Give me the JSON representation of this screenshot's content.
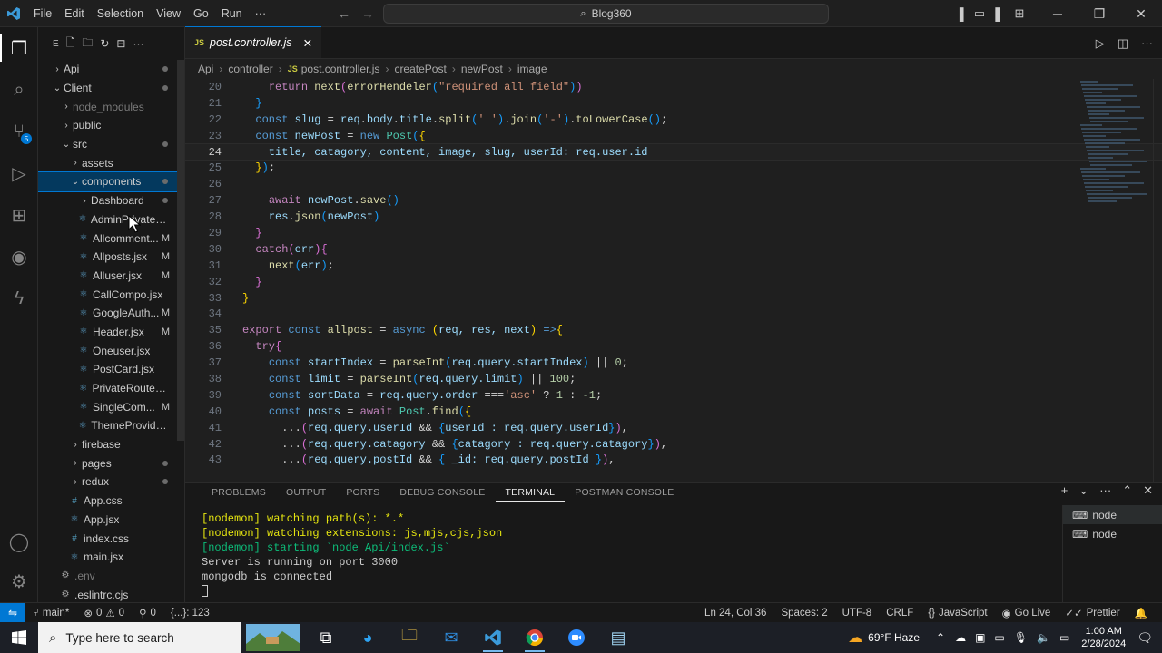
{
  "window": {
    "menu": [
      "File",
      "Edit",
      "Selection",
      "View",
      "Go",
      "Run",
      "···"
    ],
    "command_center": "Blog360"
  },
  "explorer": {
    "toolbar_letter": "E",
    "tree": [
      {
        "label": "Api",
        "indent": 1,
        "kind": "folder",
        "open": false,
        "dot": true
      },
      {
        "label": "Client",
        "indent": 1,
        "kind": "folder",
        "open": true,
        "dot": true
      },
      {
        "label": "node_modules",
        "indent": 2,
        "kind": "folder",
        "open": false,
        "dim": true
      },
      {
        "label": "public",
        "indent": 2,
        "kind": "folder",
        "open": false
      },
      {
        "label": "src",
        "indent": 2,
        "kind": "folder",
        "open": true,
        "dot": true
      },
      {
        "label": "assets",
        "indent": 3,
        "kind": "folder",
        "open": false
      },
      {
        "label": "components",
        "indent": 3,
        "kind": "folder",
        "open": true,
        "dot": true,
        "selected": true
      },
      {
        "label": "Dashboard",
        "indent": 4,
        "kind": "folder",
        "open": false,
        "dot": true
      },
      {
        "label": "AdminPrivateRou...",
        "indent": 4,
        "kind": "file"
      },
      {
        "label": "Allcomment...",
        "indent": 4,
        "kind": "file",
        "badge": "M"
      },
      {
        "label": "Allposts.jsx",
        "indent": 4,
        "kind": "file",
        "badge": "M"
      },
      {
        "label": "Alluser.jsx",
        "indent": 4,
        "kind": "file",
        "badge": "M"
      },
      {
        "label": "CallCompo.jsx",
        "indent": 4,
        "kind": "file"
      },
      {
        "label": "GoogleAuth...",
        "indent": 4,
        "kind": "file",
        "badge": "M"
      },
      {
        "label": "Header.jsx",
        "indent": 4,
        "kind": "file",
        "badge": "M"
      },
      {
        "label": "Oneuser.jsx",
        "indent": 4,
        "kind": "file"
      },
      {
        "label": "PostCard.jsx",
        "indent": 4,
        "kind": "file"
      },
      {
        "label": "PrivateRoute.jsx",
        "indent": 4,
        "kind": "file"
      },
      {
        "label": "SingleCom...",
        "indent": 4,
        "kind": "file",
        "badge": "M"
      },
      {
        "label": "ThemeProvider.jsx",
        "indent": 4,
        "kind": "file"
      },
      {
        "label": "firebase",
        "indent": 3,
        "kind": "folder",
        "open": false
      },
      {
        "label": "pages",
        "indent": 3,
        "kind": "folder",
        "open": false,
        "dot": true
      },
      {
        "label": "redux",
        "indent": 3,
        "kind": "folder",
        "open": false,
        "dot": true
      },
      {
        "label": "App.css",
        "indent": 3,
        "kind": "css"
      },
      {
        "label": "App.jsx",
        "indent": 3,
        "kind": "file"
      },
      {
        "label": "index.css",
        "indent": 3,
        "kind": "css"
      },
      {
        "label": "main.jsx",
        "indent": 3,
        "kind": "file"
      },
      {
        "label": ".env",
        "indent": 2,
        "kind": "gear",
        "dim": true
      },
      {
        "label": ".eslintrc.cjs",
        "indent": 2,
        "kind": "gear"
      }
    ]
  },
  "editor": {
    "tab": {
      "badge": "JS",
      "label": "post.controller.js"
    },
    "breadcrumb": [
      "Api",
      "controller",
      "JS",
      "post.controller.js",
      "createPost",
      "newPost",
      "image"
    ],
    "current_line": 24,
    "lines": [
      {
        "n": 20,
        "tokens": [
          [
            "    ",
            "pun"
          ],
          [
            "return ",
            "kc"
          ],
          [
            "next",
            "fn"
          ],
          [
            "(",
            "brk2"
          ],
          [
            "errorHendeler",
            "fn"
          ],
          [
            "(",
            "brk3"
          ],
          [
            "\"required all field\"",
            "str"
          ],
          [
            ")",
            "brk3"
          ],
          [
            ")",
            "brk2"
          ]
        ]
      },
      {
        "n": 21,
        "tokens": [
          [
            "  }",
            "brk3"
          ]
        ]
      },
      {
        "n": 22,
        "tokens": [
          [
            "  ",
            "pun"
          ],
          [
            "const ",
            "kw"
          ],
          [
            "slug",
            "var"
          ],
          [
            " = ",
            "pun"
          ],
          [
            "req",
            "var"
          ],
          [
            ".",
            "pun"
          ],
          [
            "body",
            "var"
          ],
          [
            ".",
            "pun"
          ],
          [
            "title",
            "var"
          ],
          [
            ".",
            "pun"
          ],
          [
            "split",
            "fn"
          ],
          [
            "(",
            "brk3"
          ],
          [
            "' '",
            "str"
          ],
          [
            ")",
            "brk3"
          ],
          [
            ".",
            "pun"
          ],
          [
            "join",
            "fn"
          ],
          [
            "(",
            "brk3"
          ],
          [
            "'-'",
            "str"
          ],
          [
            ")",
            "brk3"
          ],
          [
            ".",
            "pun"
          ],
          [
            "toLowerCase",
            "fn"
          ],
          [
            "()",
            "brk3"
          ],
          [
            ";",
            "pun"
          ]
        ]
      },
      {
        "n": 23,
        "tokens": [
          [
            "  ",
            "pun"
          ],
          [
            "const ",
            "kw"
          ],
          [
            "newPost",
            "var"
          ],
          [
            " = ",
            "pun"
          ],
          [
            "new ",
            "kw"
          ],
          [
            "Post",
            "cls"
          ],
          [
            "(",
            "brk3"
          ],
          [
            "{",
            "brk"
          ]
        ]
      },
      {
        "n": 24,
        "tokens": [
          [
            "    title, catagory, content, image, slug, userId: req.user.id",
            "var"
          ]
        ]
      },
      {
        "n": 25,
        "tokens": [
          [
            "  ",
            "pun"
          ],
          [
            "}",
            "brk"
          ],
          [
            ")",
            "brk3"
          ],
          [
            ";",
            "pun"
          ]
        ]
      },
      {
        "n": 26,
        "tokens": [
          [
            "",
            "pun"
          ]
        ]
      },
      {
        "n": 27,
        "tokens": [
          [
            "    ",
            "pun"
          ],
          [
            "await ",
            "kc"
          ],
          [
            "newPost",
            "var"
          ],
          [
            ".",
            "pun"
          ],
          [
            "save",
            "fn"
          ],
          [
            "()",
            "brk3"
          ]
        ]
      },
      {
        "n": 28,
        "tokens": [
          [
            "    ",
            "pun"
          ],
          [
            "res",
            "var"
          ],
          [
            ".",
            "pun"
          ],
          [
            "json",
            "fn"
          ],
          [
            "(",
            "brk3"
          ],
          [
            "newPost",
            "var"
          ],
          [
            ")",
            "brk3"
          ]
        ]
      },
      {
        "n": 29,
        "tokens": [
          [
            "  }",
            "brk2"
          ]
        ]
      },
      {
        "n": 30,
        "tokens": [
          [
            "  ",
            "pun"
          ],
          [
            "catch",
            "kc"
          ],
          [
            "(",
            "brk2"
          ],
          [
            "err",
            "var"
          ],
          [
            ")",
            "brk2"
          ],
          [
            "{",
            "brk2"
          ]
        ]
      },
      {
        "n": 31,
        "tokens": [
          [
            "    ",
            "pun"
          ],
          [
            "next",
            "fn"
          ],
          [
            "(",
            "brk3"
          ],
          [
            "err",
            "var"
          ],
          [
            ")",
            "brk3"
          ],
          [
            ";",
            "pun"
          ]
        ]
      },
      {
        "n": 32,
        "tokens": [
          [
            "  }",
            "brk2"
          ]
        ]
      },
      {
        "n": 33,
        "tokens": [
          [
            "}",
            "brk"
          ]
        ]
      },
      {
        "n": 34,
        "tokens": [
          [
            "",
            "pun"
          ]
        ]
      },
      {
        "n": 35,
        "tokens": [
          [
            "export ",
            "kc"
          ],
          [
            "const ",
            "kw"
          ],
          [
            "allpost",
            "fn"
          ],
          [
            " = ",
            "pun"
          ],
          [
            "async ",
            "kw"
          ],
          [
            "(",
            "brk"
          ],
          [
            "req, res, next",
            "var"
          ],
          [
            ")",
            "brk"
          ],
          [
            " =>",
            "kw"
          ],
          [
            "{",
            "brk"
          ]
        ]
      },
      {
        "n": 36,
        "tokens": [
          [
            "  ",
            "pun"
          ],
          [
            "try",
            "kc"
          ],
          [
            "{",
            "brk2"
          ]
        ]
      },
      {
        "n": 37,
        "tokens": [
          [
            "    ",
            "pun"
          ],
          [
            "const ",
            "kw"
          ],
          [
            "startIndex",
            "var"
          ],
          [
            " = ",
            "pun"
          ],
          [
            "parseInt",
            "fn"
          ],
          [
            "(",
            "brk3"
          ],
          [
            "req.query.startIndex",
            "var"
          ],
          [
            ")",
            "brk3"
          ],
          [
            " || ",
            "pun"
          ],
          [
            "0",
            "num"
          ],
          [
            ";",
            "pun"
          ]
        ]
      },
      {
        "n": 38,
        "tokens": [
          [
            "    ",
            "pun"
          ],
          [
            "const ",
            "kw"
          ],
          [
            "limit",
            "var"
          ],
          [
            " = ",
            "pun"
          ],
          [
            "parseInt",
            "fn"
          ],
          [
            "(",
            "brk3"
          ],
          [
            "req.query.limit",
            "var"
          ],
          [
            ")",
            "brk3"
          ],
          [
            " || ",
            "pun"
          ],
          [
            "100",
            "num"
          ],
          [
            ";",
            "pun"
          ]
        ]
      },
      {
        "n": 39,
        "tokens": [
          [
            "    ",
            "pun"
          ],
          [
            "const ",
            "kw"
          ],
          [
            "sortData",
            "var"
          ],
          [
            " = ",
            "pun"
          ],
          [
            "req.query.order",
            "var"
          ],
          [
            " ===",
            "pun"
          ],
          [
            "'asc'",
            "str"
          ],
          [
            " ? ",
            "pun"
          ],
          [
            "1",
            "num"
          ],
          [
            " : ",
            "pun"
          ],
          [
            "-1",
            "num"
          ],
          [
            ";",
            "pun"
          ]
        ]
      },
      {
        "n": 40,
        "tokens": [
          [
            "    ",
            "pun"
          ],
          [
            "const ",
            "kw"
          ],
          [
            "posts",
            "var"
          ],
          [
            " = ",
            "pun"
          ],
          [
            "await ",
            "kc"
          ],
          [
            "Post",
            "cls"
          ],
          [
            ".",
            "pun"
          ],
          [
            "find",
            "fn"
          ],
          [
            "(",
            "brk3"
          ],
          [
            "{",
            "brk"
          ]
        ]
      },
      {
        "n": 41,
        "tokens": [
          [
            "      ...",
            "pun"
          ],
          [
            "(",
            "brk2"
          ],
          [
            "req.query.userId",
            "var"
          ],
          [
            " && ",
            "pun"
          ],
          [
            "{",
            "brk3"
          ],
          [
            "userId : req.query.userId",
            "var"
          ],
          [
            "}",
            "brk3"
          ],
          [
            ")",
            "brk2"
          ],
          [
            ",",
            "pun"
          ]
        ]
      },
      {
        "n": 42,
        "tokens": [
          [
            "      ...",
            "pun"
          ],
          [
            "(",
            "brk2"
          ],
          [
            "req.query.catagory",
            "var"
          ],
          [
            " && ",
            "pun"
          ],
          [
            "{",
            "brk3"
          ],
          [
            "catagory : req.query.catagory",
            "var"
          ],
          [
            "}",
            "brk3"
          ],
          [
            ")",
            "brk2"
          ],
          [
            ",",
            "pun"
          ]
        ]
      },
      {
        "n": 43,
        "tokens": [
          [
            "      ...",
            "pun"
          ],
          [
            "(",
            "brk2"
          ],
          [
            "req.query.postId",
            "var"
          ],
          [
            " && ",
            "pun"
          ],
          [
            "{",
            "brk3"
          ],
          [
            " _id: req.query.postId ",
            "var"
          ],
          [
            "}",
            "brk3"
          ],
          [
            ")",
            "brk2"
          ],
          [
            ",",
            "pun"
          ]
        ]
      }
    ]
  },
  "panel": {
    "tabs": [
      "PROBLEMS",
      "OUTPUT",
      "PORTS",
      "DEBUG CONSOLE",
      "TERMINAL",
      "POSTMAN CONSOLE"
    ],
    "active_tab": "TERMINAL",
    "terminal": [
      {
        "text": "[nodemon] watching path(s): *.*",
        "color": "ylw"
      },
      {
        "text": "[nodemon] watching extensions: js,mjs,cjs,json",
        "color": "ylw"
      },
      {
        "text": "[nodemon] starting `node Api/index.js`",
        "color": "grn"
      },
      {
        "text": "Server is running on port 3000",
        "color": ""
      },
      {
        "text": "mongodb is connected",
        "color": ""
      }
    ],
    "terminals": [
      "node",
      "node"
    ]
  },
  "statusbar": {
    "branch": "main*",
    "errors": "0",
    "warnings": "0",
    "ports": "0",
    "selection": "{...}: 123",
    "position": "Ln 24, Col 36",
    "spaces": "Spaces: 2",
    "encoding": "UTF-8",
    "eol": "CRLF",
    "language": "JavaScript",
    "golive": "Go Live",
    "prettier": "Prettier"
  },
  "taskbar": {
    "search_placeholder": "Type here to search",
    "weather": "69°F  Haze",
    "time": "1:00 AM",
    "date": "2/28/2024"
  },
  "colors": {
    "accent": "#0078d4",
    "selection": "#04395e"
  }
}
